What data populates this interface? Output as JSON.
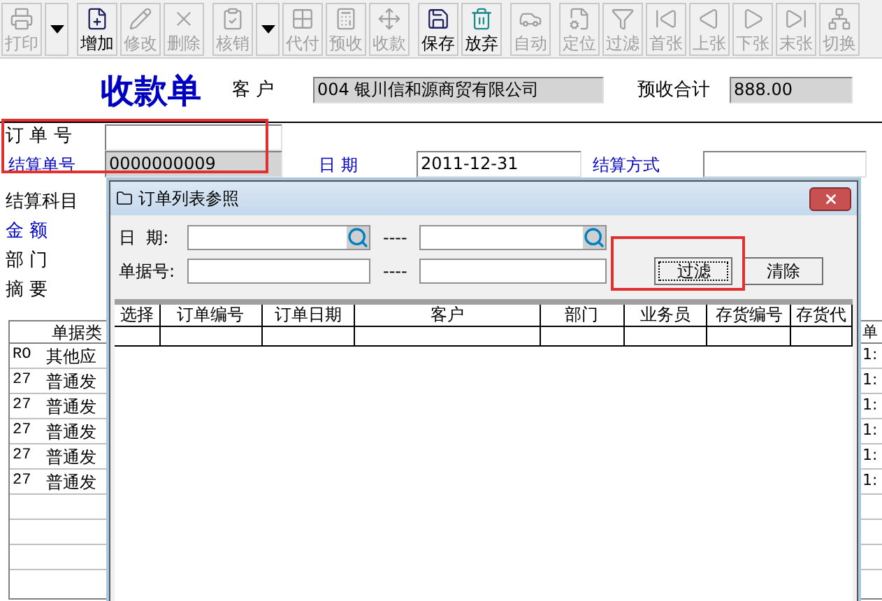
{
  "toolbar": [
    [
      {
        "kind": "button",
        "label": "打印",
        "disabled": true
      },
      {
        "kind": "dropdown",
        "disabled": false
      }
    ],
    [
      {
        "kind": "button",
        "label": "增加",
        "disabled": false
      },
      {
        "kind": "button",
        "label": "修改",
        "disabled": true
      },
      {
        "kind": "button",
        "label": "删除",
        "disabled": true
      }
    ],
    [
      {
        "kind": "button",
        "label": "核销",
        "disabled": true
      },
      {
        "kind": "dropdown",
        "disabled": false
      },
      {
        "kind": "button",
        "label": "代付",
        "disabled": true
      },
      {
        "kind": "button",
        "label": "预收",
        "disabled": true
      },
      {
        "kind": "button",
        "label": "收款",
        "disabled": true
      }
    ],
    [
      {
        "kind": "button",
        "label": "保存",
        "disabled": false
      },
      {
        "kind": "button",
        "label": "放弃",
        "disabled": false
      }
    ],
    [
      {
        "kind": "button",
        "label": "自动",
        "disabled": true
      }
    ],
    [
      {
        "kind": "button",
        "label": "定位",
        "disabled": true
      },
      {
        "kind": "button",
        "label": "过滤",
        "disabled": true
      },
      {
        "kind": "button",
        "label": "首张",
        "disabled": true
      },
      {
        "kind": "button",
        "label": "上张",
        "disabled": true
      },
      {
        "kind": "button",
        "label": "下张",
        "disabled": true
      },
      {
        "kind": "button",
        "label": "末张",
        "disabled": true
      },
      {
        "kind": "button",
        "label": "切换",
        "disabled": true
      }
    ]
  ],
  "form": {
    "title": "收款单",
    "customer_label": "客 户",
    "customer": "004  银川信和源商贸有限公司",
    "prepaid_label": "预收合计",
    "prepaid": "888.00",
    "order_no_label": "订 单 号",
    "settle_no_label": "结算单号",
    "settle_no": "0000000009",
    "date_label": "日 期",
    "date": "2011-12-31",
    "settle_method_label": "结算方式",
    "labels": [
      {
        "text": "结算科目",
        "blue": false
      },
      {
        "text": "金 额",
        "blue": true
      },
      {
        "text": "部 门",
        "blue": false
      },
      {
        "text": "摘 要",
        "blue": false
      }
    ]
  },
  "list": {
    "header": "单据类",
    "rows": [
      {
        "code": "RO",
        "type": "其他应"
      },
      {
        "code": "27",
        "type": "普通发"
      },
      {
        "code": "27",
        "type": "普通发"
      },
      {
        "code": "27",
        "type": "普通发"
      },
      {
        "code": "27",
        "type": "普通发"
      },
      {
        "code": "27",
        "type": "普通发"
      }
    ],
    "right_header": "单",
    "right_cells": [
      "1:",
      "1:",
      "1:",
      "1:",
      "1:",
      "1:"
    ]
  },
  "dialog": {
    "title": "订单列表参照",
    "date_label": "日  期:",
    "doc_no_label": "单据号:",
    "range_sep": "----",
    "filter_button": "过滤",
    "clear_button": "清除",
    "columns": [
      "选择",
      "订单编号",
      "订单日期",
      "客户",
      "部门",
      "业务员",
      "存货编号",
      "存货代"
    ]
  }
}
